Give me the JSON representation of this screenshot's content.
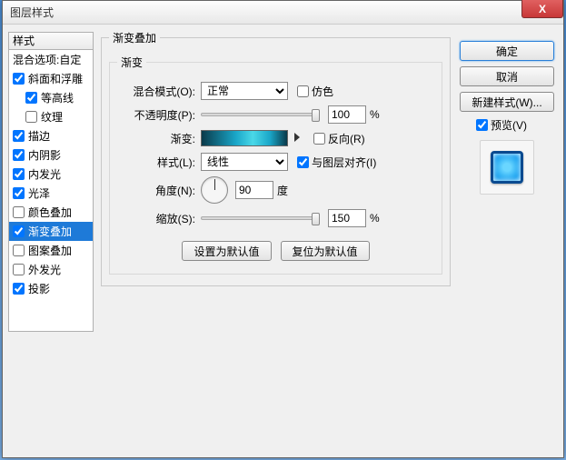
{
  "title": "图层样式",
  "close_x": "X",
  "left": {
    "header": "样式",
    "blend_options": "混合选项:自定",
    "items": [
      {
        "label": "斜面和浮雕",
        "checked": true,
        "sub": false
      },
      {
        "label": "等高线",
        "checked": true,
        "sub": true
      },
      {
        "label": "纹理",
        "checked": false,
        "sub": true
      },
      {
        "label": "描边",
        "checked": true,
        "sub": false
      },
      {
        "label": "内阴影",
        "checked": true,
        "sub": false
      },
      {
        "label": "内发光",
        "checked": true,
        "sub": false
      },
      {
        "label": "光泽",
        "checked": true,
        "sub": false
      },
      {
        "label": "颜色叠加",
        "checked": false,
        "sub": false
      },
      {
        "label": "渐变叠加",
        "checked": true,
        "sub": false,
        "selected": true
      },
      {
        "label": "图案叠加",
        "checked": false,
        "sub": false
      },
      {
        "label": "外发光",
        "checked": false,
        "sub": false
      },
      {
        "label": "投影",
        "checked": true,
        "sub": false
      }
    ]
  },
  "group_title": "渐变叠加",
  "inner_title": "渐变",
  "rows": {
    "blend_mode_label": "混合模式(O):",
    "blend_mode_value": "正常",
    "dither_label": "仿色",
    "opacity_label": "不透明度(P):",
    "opacity_value": "100",
    "opacity_unit": "%",
    "gradient_label": "渐变:",
    "reverse_label": "反向(R)",
    "style_label": "样式(L):",
    "style_value": "线性",
    "align_label": "与图层对齐(I)",
    "angle_label": "角度(N):",
    "angle_value": "90",
    "angle_unit": "度",
    "scale_label": "缩放(S):",
    "scale_value": "150",
    "scale_unit": "%"
  },
  "buttons": {
    "set_default": "设置为默认值",
    "reset_default": "复位为默认值"
  },
  "right": {
    "ok": "确定",
    "cancel": "取消",
    "new_style": "新建样式(W)...",
    "preview": "预览(V)"
  }
}
